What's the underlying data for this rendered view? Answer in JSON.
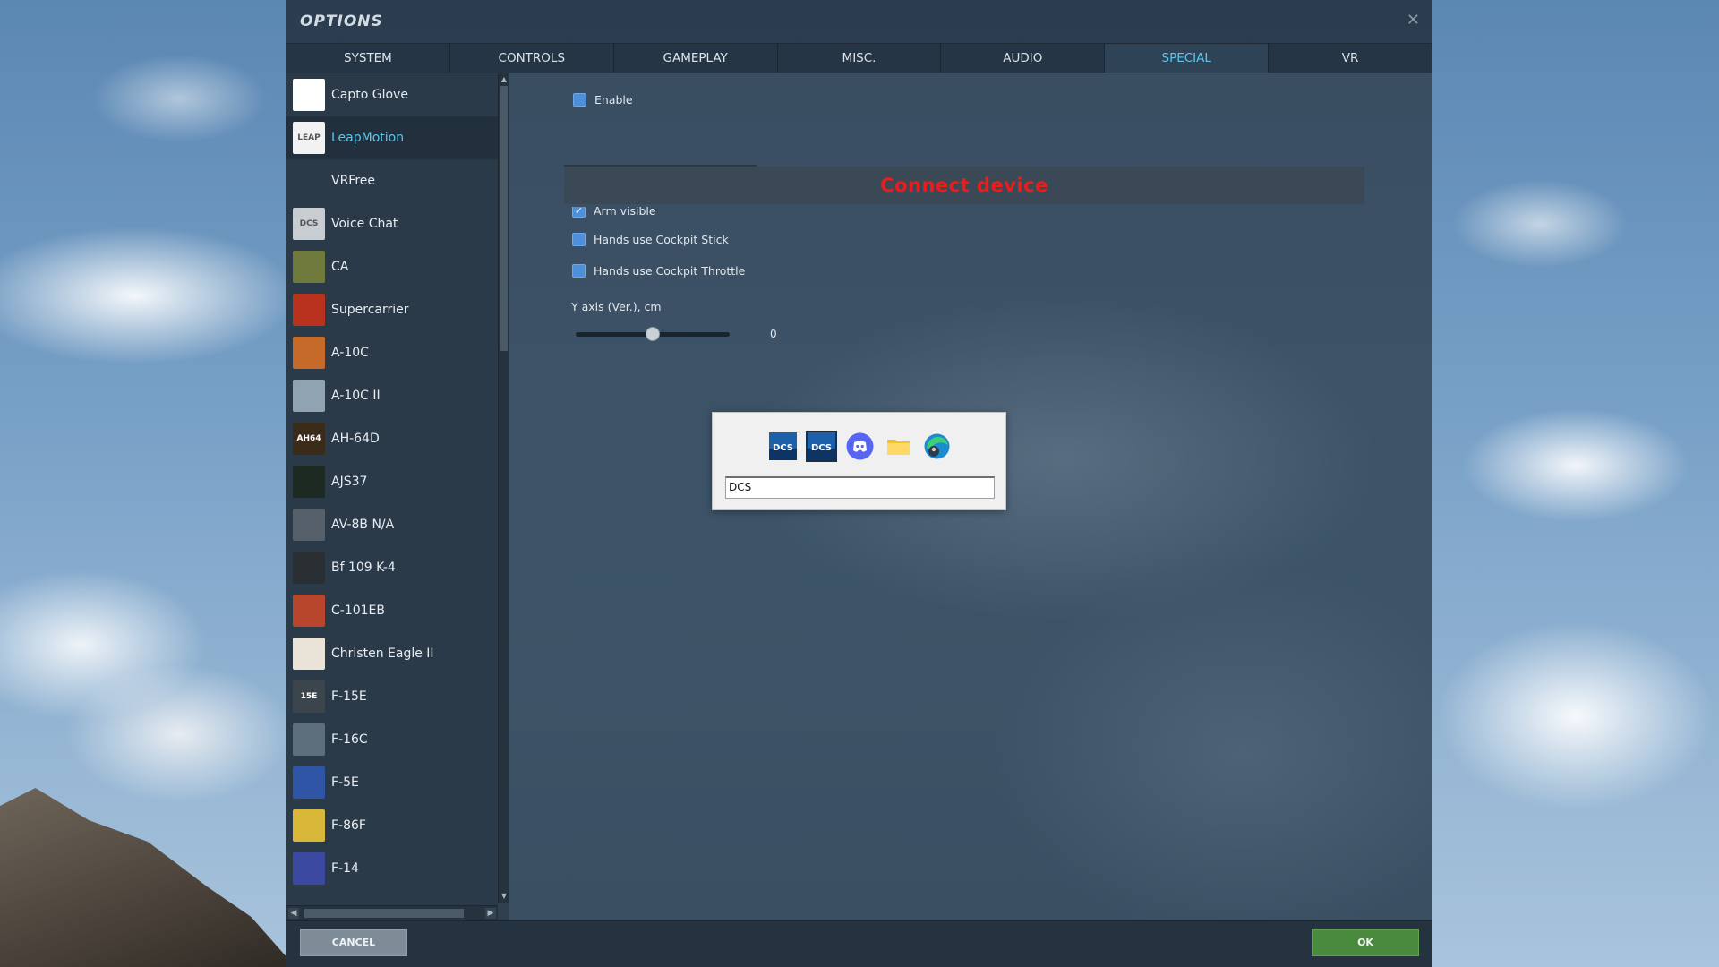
{
  "window": {
    "title": "OPTIONS",
    "close_glyph": "✕"
  },
  "tabs": [
    {
      "label": "SYSTEM"
    },
    {
      "label": "CONTROLS"
    },
    {
      "label": "GAMEPLAY"
    },
    {
      "label": "MISC."
    },
    {
      "label": "AUDIO"
    },
    {
      "label": "SPECIAL"
    },
    {
      "label": "VR"
    }
  ],
  "active_tab": "SPECIAL",
  "sidebar": {
    "items": [
      {
        "label": "Capto Glove",
        "icon": "capto-glove-icon",
        "color": "#ffffff",
        "glyph": "",
        "active": false
      },
      {
        "label": "LeapMotion",
        "icon": "leapmotion-icon",
        "color": "#f2f2f2",
        "glyph": "LEAP",
        "active": true
      },
      {
        "label": "VRFree",
        "icon": "vrfree-icon",
        "color": "#2b3a49",
        "glyph": "",
        "active": false
      },
      {
        "label": "Voice Chat",
        "icon": "voice-chat-icon",
        "color": "#c8cdd1",
        "glyph": "DCS",
        "active": false
      },
      {
        "label": "CA",
        "icon": "ca-icon",
        "color": "#6f7a3c",
        "glyph": "",
        "active": false
      },
      {
        "label": "Supercarrier",
        "icon": "supercarrier-icon",
        "color": "#b8321e",
        "glyph": "",
        "active": false
      },
      {
        "label": "A-10C",
        "icon": "a10c-icon",
        "color": "#c66a2a",
        "glyph": "",
        "active": false
      },
      {
        "label": "A-10C II",
        "icon": "a10c2-icon",
        "color": "#8fa3b3",
        "glyph": "",
        "active": false
      },
      {
        "label": "AH-64D",
        "icon": "ah64d-icon",
        "color": "#3a2c18",
        "glyph": "AH64",
        "active": false
      },
      {
        "label": "AJS37",
        "icon": "ajs37-icon",
        "color": "#1c2a22",
        "glyph": "",
        "active": false
      },
      {
        "label": "AV-8B N/A",
        "icon": "av8b-icon",
        "color": "#56606a",
        "glyph": "",
        "active": false
      },
      {
        "label": "Bf 109 K-4",
        "icon": "bf109-icon",
        "color": "#2a2f33",
        "glyph": "",
        "active": false
      },
      {
        "label": "C-101EB",
        "icon": "c101eb-icon",
        "color": "#b7462c",
        "glyph": "",
        "active": false
      },
      {
        "label": "Christen Eagle II",
        "icon": "christen-eagle-icon",
        "color": "#e9e3d8",
        "glyph": "",
        "active": false
      },
      {
        "label": "F-15E",
        "icon": "f15e-icon",
        "color": "#3d454c",
        "glyph": "15E",
        "active": false
      },
      {
        "label": "F-16C",
        "icon": "f16c-icon",
        "color": "#5d6f7c",
        "glyph": "",
        "active": false
      },
      {
        "label": "F-5E",
        "icon": "f5e-icon",
        "color": "#2f56a6",
        "glyph": "",
        "active": false
      },
      {
        "label": "F-86F",
        "icon": "f86f-icon",
        "color": "#d9b739",
        "glyph": "",
        "active": false
      },
      {
        "label": "F-14",
        "icon": "f14-icon",
        "color": "#3b4aa0",
        "glyph": "",
        "active": false
      }
    ]
  },
  "main": {
    "enable": {
      "label": "Enable",
      "checked": false
    },
    "connect_banner": "Connect device",
    "arm_visible": {
      "label": "Arm visible",
      "checked": true
    },
    "hands_stick": {
      "label": "Hands use Cockpit Stick",
      "checked": false
    },
    "hands_throttle": {
      "label": "Hands use Cockpit Throttle",
      "checked": false
    },
    "y_axis": {
      "label": "Y axis (Ver.), cm",
      "value": "0",
      "fraction": 0.5
    }
  },
  "switcher": {
    "icons": [
      {
        "name": "dcs-app-icon",
        "label": "DCS"
      },
      {
        "name": "dcs-app-icon-selected",
        "label": "DCS"
      },
      {
        "name": "discord-icon",
        "label": ""
      },
      {
        "name": "file-explorer-icon",
        "label": ""
      },
      {
        "name": "edge-browser-icon",
        "label": ""
      }
    ],
    "selected_index": 1,
    "input_value": "DCS"
  },
  "footer": {
    "cancel_label": "CANCEL",
    "ok_label": "OK"
  },
  "colors": {
    "accent": "#5cc6ee",
    "ok": "#4a8a3c",
    "banner_text": "#ee1b1b",
    "checkbox": "#4d8fd8"
  }
}
